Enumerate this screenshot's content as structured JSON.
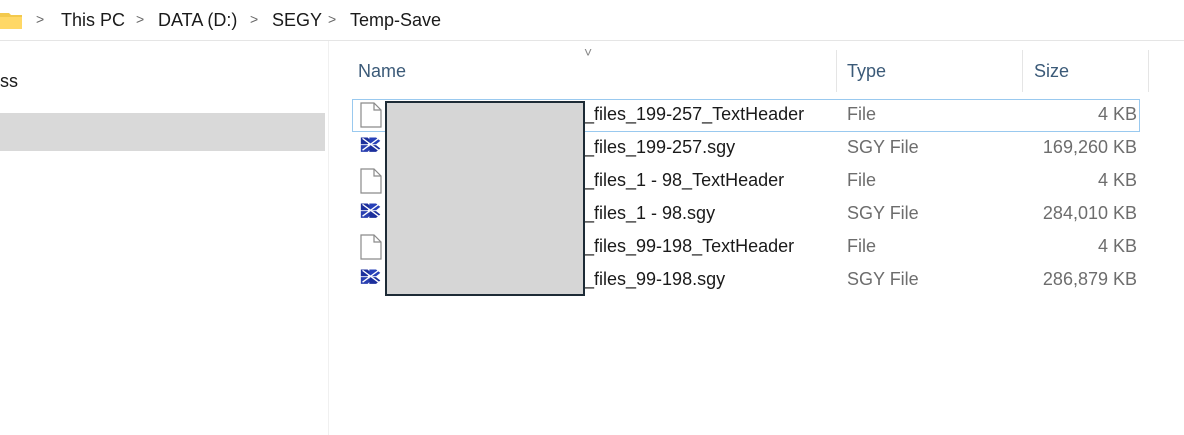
{
  "address": {
    "folder_icon": "folder-icon",
    "crumbs": [
      "This PC",
      "DATA (D:)",
      "SEGY",
      "Temp-Save"
    ],
    "separator": ">"
  },
  "nav": {
    "fragment": "ss"
  },
  "header": {
    "sort_chevron": "˅",
    "name": "Name",
    "type": "Type",
    "size": "Size"
  },
  "files": [
    {
      "name": "_files_199-257_TextHeader",
      "type": "File",
      "size": "4 KB",
      "icon": "file-icon"
    },
    {
      "name": "_files_199-257.sgy",
      "type": "SGY File",
      "size": "169,260 KB",
      "icon": "sgy-icon"
    },
    {
      "name": "_files_1 - 98_TextHeader",
      "type": "File",
      "size": "4 KB",
      "icon": "file-icon"
    },
    {
      "name": "_files_1 - 98.sgy",
      "type": "SGY File",
      "size": "284,010 KB",
      "icon": "sgy-icon"
    },
    {
      "name": "_files_99-198_TextHeader",
      "type": "File",
      "size": "4 KB",
      "icon": "file-icon"
    },
    {
      "name": "_files_99-198.sgy",
      "type": "SGY File",
      "size": "286,879 KB",
      "icon": "sgy-icon"
    }
  ]
}
